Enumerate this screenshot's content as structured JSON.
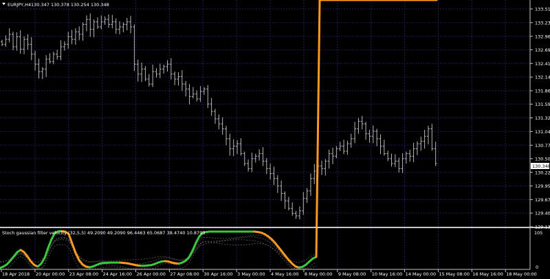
{
  "main_pane": {
    "symbol_icon": "triangle-down-icon",
    "title": "EURJPY,H4",
    "ohlc": "130.347 130.378 130.254 130.348",
    "price_labels": [
      "133.510",
      "133.235",
      "132.960",
      "132.690",
      "132.415",
      "132.140",
      "131.865",
      "131.595",
      "131.320",
      "131.045",
      "130.770",
      "130.500",
      "130.225",
      "129.950",
      "129.675",
      "129.405",
      "129.130"
    ],
    "current_price": "130.348",
    "ylim": [
      129.13,
      133.51
    ]
  },
  "indicator_pane": {
    "title": "Stoch gaussian filter velocity (32,5,5) 49.2090 49.2090 96.4463 65.0687 38.4740 10.8793",
    "scale_top": "105",
    "scale_bottom": "0",
    "ylim": [
      0,
      105
    ]
  },
  "time_axis": {
    "labels": [
      "18 Apr 2018",
      "20 Apr 00:00",
      "23 Apr 08:00",
      "24 Apr 16:00",
      "26 Apr 00:00",
      "27 Apr 08:00",
      "30 Apr 16:00",
      "3 May 00:00",
      "4 May 16:00",
      "8 May 00:00",
      "9 May 08:00",
      "10 May 16:00",
      "14 May 00:00",
      "15 May 08:00",
      "16 May 16:00",
      "18 May 00:00"
    ]
  },
  "colors": {
    "background": "#000000",
    "grid": "#1f1f5e",
    "candle": "#b8b8b8",
    "axis": "#c8c8c8",
    "text": "#ffffff",
    "bull": "#3cc83c",
    "bear": "#ff9a1e",
    "band": "#5c5c5c"
  },
  "chart_data": [
    {
      "type": "ohlc",
      "title": "EURJPY,H4",
      "ylim": [
        129.13,
        133.51
      ],
      "close": [
        132.8,
        132.9,
        133.0,
        132.75,
        132.95,
        132.7,
        132.9,
        132.8,
        132.6,
        132.4,
        132.25,
        132.3,
        132.5,
        132.45,
        132.6,
        132.55,
        132.75,
        132.8,
        132.95,
        132.9,
        133.05,
        133.0,
        133.2,
        133.3,
        133.1,
        133.25,
        133.15,
        133.25,
        133.3,
        133.2,
        133.25,
        133.1,
        133.15,
        133.2,
        133.25,
        133.15,
        132.4,
        132.2,
        132.3,
        132.1,
        132.0,
        132.25,
        132.2,
        132.3,
        132.35,
        132.4,
        132.2,
        132.1,
        132.15,
        132.0,
        131.9,
        131.75,
        131.8,
        131.7,
        131.85,
        131.9,
        131.6,
        131.45,
        131.3,
        131.2,
        131.1,
        130.9,
        130.7,
        130.75,
        130.8,
        130.6,
        130.4,
        130.3,
        130.5,
        130.55,
        130.6,
        130.45,
        130.3,
        130.2,
        130.1,
        129.95,
        129.8,
        129.65,
        129.5,
        129.4,
        129.35,
        129.45,
        129.7,
        129.85,
        130.1,
        130.25,
        130.35,
        130.3,
        130.45,
        130.6,
        130.55,
        130.7,
        130.75,
        130.65,
        130.8,
        130.9,
        131.1,
        131.25,
        131.2,
        131.0,
        130.95,
        131.05,
        130.9,
        130.75,
        130.6,
        130.5,
        130.4,
        130.45,
        130.3,
        130.5,
        130.6,
        130.55,
        130.7,
        130.8,
        130.85,
        130.95,
        131.1,
        130.7,
        130.4
      ]
    },
    {
      "type": "line",
      "title": "Stoch gaussian filter velocity (32,5,5)",
      "ylim": [
        0,
        105
      ],
      "x": [
        0,
        5,
        10,
        15,
        20,
        25,
        30,
        35,
        40,
        45,
        50,
        55,
        60,
        65,
        70,
        75,
        80,
        85,
        90,
        95,
        100,
        105,
        110,
        115,
        120,
        125,
        130,
        135,
        140,
        145,
        150,
        155,
        160,
        165,
        170,
        175,
        180,
        185,
        190,
        195,
        200,
        205,
        210,
        215,
        220,
        225,
        230,
        235,
        240,
        245,
        250,
        255,
        260,
        265,
        270,
        275,
        280,
        285,
        290,
        295,
        300,
        305,
        310,
        315,
        320,
        325,
        330,
        335,
        340,
        345,
        350,
        355,
        360,
        365,
        370,
        375,
        380,
        385,
        390,
        395,
        400,
        405,
        410,
        415,
        420,
        425,
        430,
        435,
        440,
        445,
        450,
        455,
        460,
        465,
        470,
        475,
        480,
        485,
        490,
        495,
        500,
        505,
        510,
        515,
        520,
        525,
        530,
        535,
        540,
        545,
        550,
        555,
        560,
        565,
        570,
        575,
        580,
        585,
        590,
        595,
        600,
        605,
        610,
        615,
        620,
        625,
        630,
        635
      ],
      "values": [
        2,
        6,
        12,
        22,
        34,
        46,
        52,
        46,
        34,
        20,
        10,
        6,
        14,
        30,
        58,
        82,
        100,
        104,
        104,
        103,
        96,
        70,
        44,
        24,
        12,
        6,
        4,
        6,
        10,
        14,
        16,
        16,
        17,
        17,
        17,
        17,
        16,
        15,
        13,
        11,
        9,
        8,
        8,
        9,
        10,
        13,
        17,
        20,
        21,
        20,
        17,
        15,
        14,
        17,
        22,
        32,
        50,
        72,
        90,
        100,
        102,
        103,
        103,
        103,
        103,
        103,
        103,
        103,
        103,
        103,
        103,
        103,
        103,
        103,
        103,
        102,
        100,
        96,
        90,
        82,
        72,
        60,
        48,
        36,
        24,
        14,
        6,
        3,
        5,
        11,
        20,
        28,
        33
      ]
    }
  ]
}
